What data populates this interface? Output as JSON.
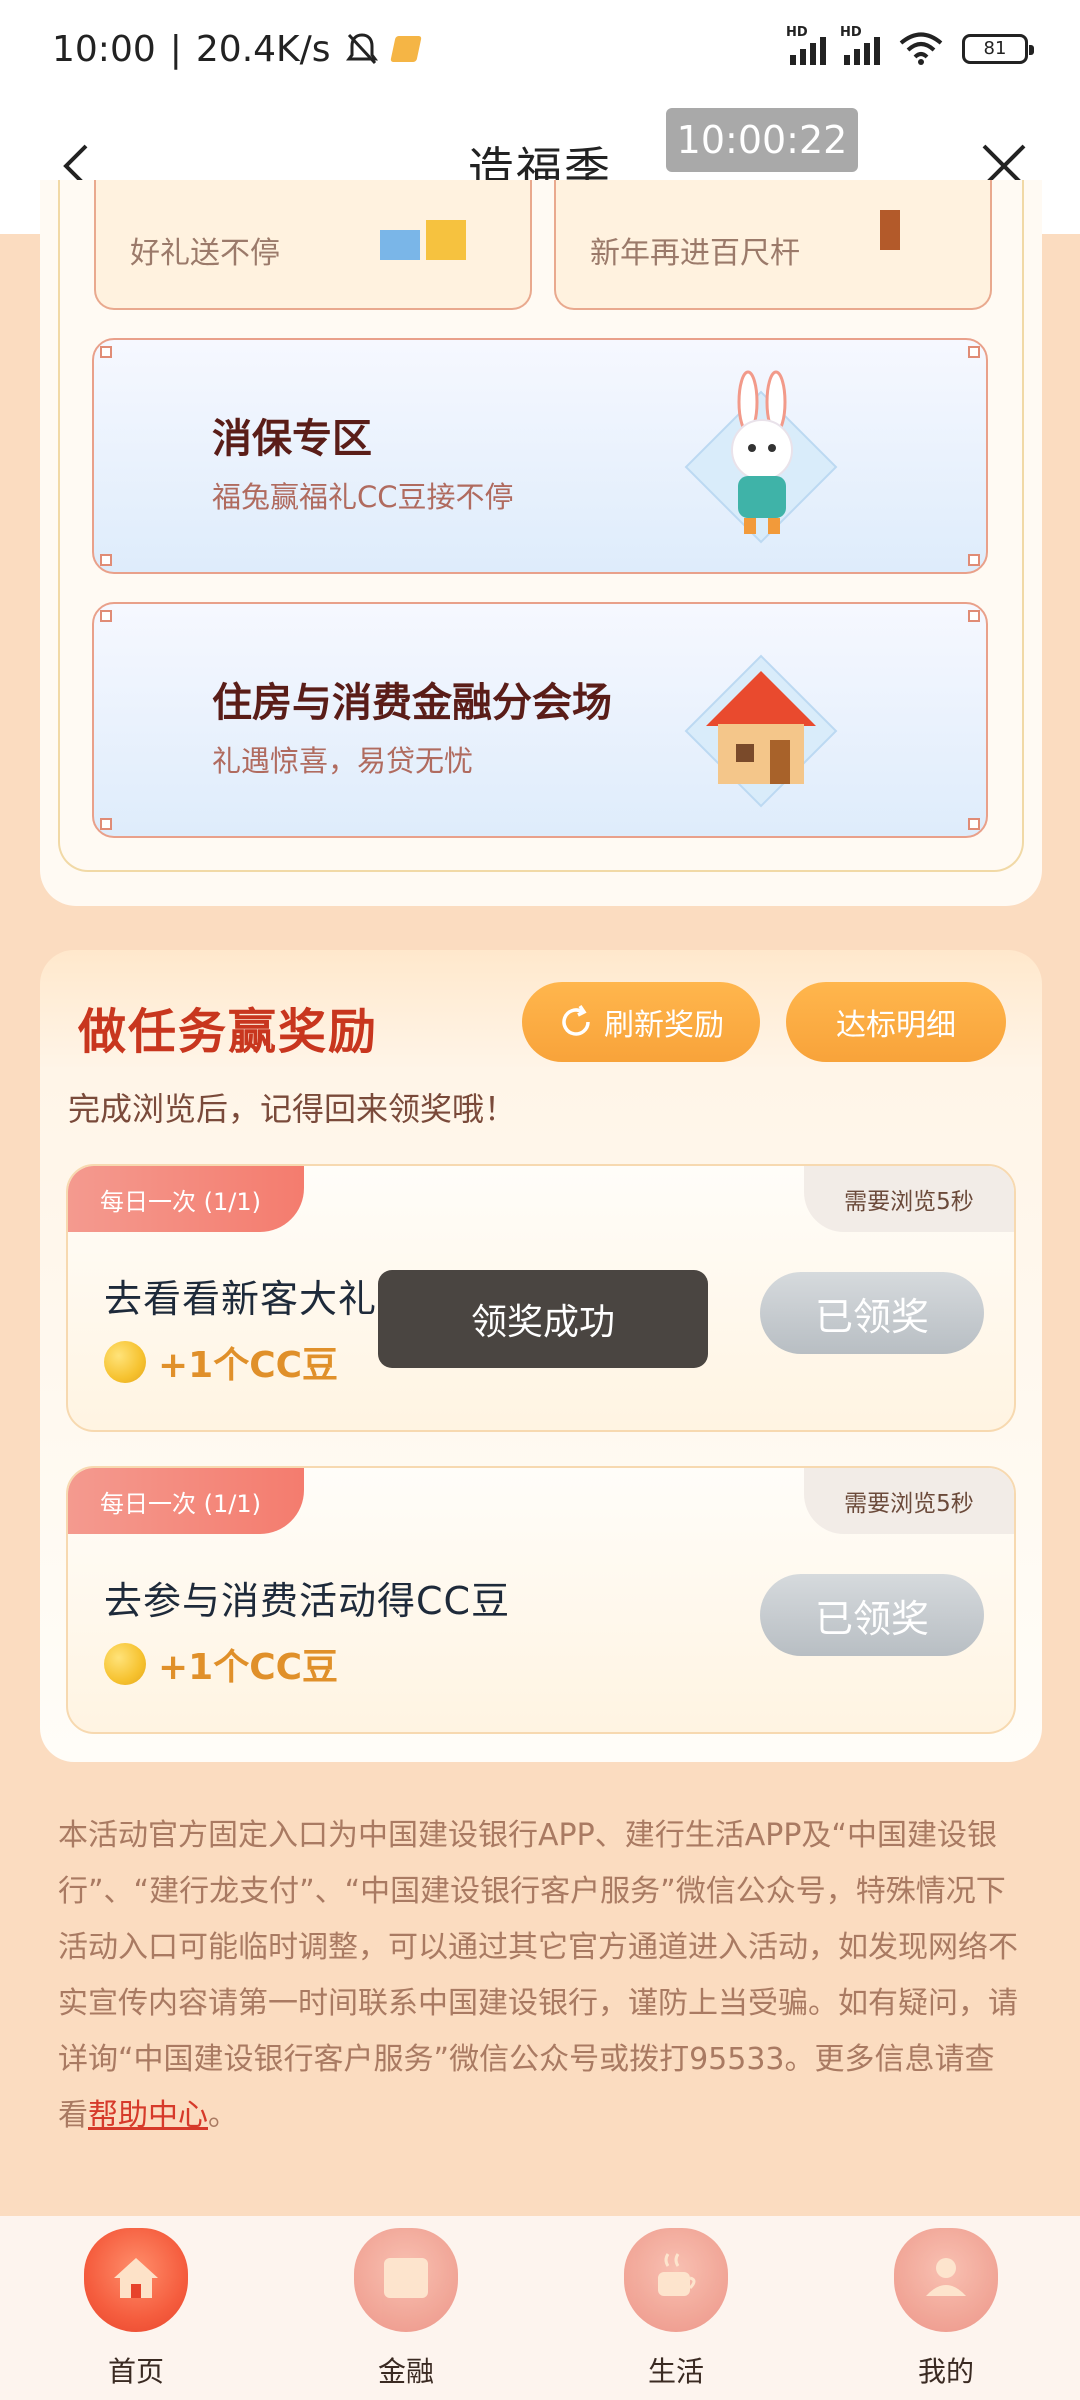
{
  "status_bar": {
    "time": "10:00",
    "net_speed": "20.4K/s",
    "battery": "81",
    "hd1": "HD",
    "hd2": "HD"
  },
  "nav": {
    "title": "造福季",
    "time_overlay": "10:00:22"
  },
  "top_tiles": [
    {
      "label": "好礼送不停"
    },
    {
      "label": "新年再进百尺杆"
    }
  ],
  "zones": [
    {
      "title": "消保专区",
      "subtitle": "福兔赢福礼CC豆接不停"
    },
    {
      "title": "住房与消费金融分会场",
      "subtitle": "礼遇惊喜，易贷无忧"
    }
  ],
  "task_section": {
    "title": "做任务赢奖励",
    "refresh_label": "刷新奖励",
    "detail_label": "达标明细",
    "hint": "完成浏览后，记得回来领奖哦！",
    "tasks": [
      {
        "frequency": "每日一次 (1/1)",
        "browse_tag": "需要浏览5秒",
        "name": "去看看新客大礼包",
        "reward": "+1个CC豆",
        "button": "已领奖"
      },
      {
        "frequency": "每日一次 (1/1)",
        "browse_tag": "需要浏览5秒",
        "name": "去参与消费活动得CC豆",
        "reward": "+1个CC豆",
        "button": "已领奖"
      }
    ]
  },
  "toast": "领奖成功",
  "disclaimer": {
    "text": "本活动官方固定入口为中国建设银行APP、建行生活APP及“中国建设银行”、“建行龙支付”、“中国建设银行客户服务”微信公众号，特殊情况下活动入口可能临时调整，可以通过其它官方通道进入活动，如发现网络不实宣传内容请第一时间联系中国建设银行，谨防上当受骗。如有疑问，请详询“中国建设银行客户服务”微信公众号或拨打95533。更多信息请查看",
    "link": "帮助中心",
    "end": "。"
  },
  "tab_bar": [
    {
      "label": "首页",
      "icon": "home-icon",
      "active": true
    },
    {
      "label": "金融",
      "icon": "wallet-icon",
      "active": false
    },
    {
      "label": "生活",
      "icon": "coffee-cup-icon",
      "active": false
    },
    {
      "label": "我的",
      "icon": "profile-icon",
      "active": false
    }
  ],
  "colors": {
    "page_bg": "#fbdcc0",
    "accent_orange": "#f8a33a",
    "title_red": "#c8361e",
    "badge_red": "#f47c6e",
    "claimed_gray": "#b8bec3"
  }
}
